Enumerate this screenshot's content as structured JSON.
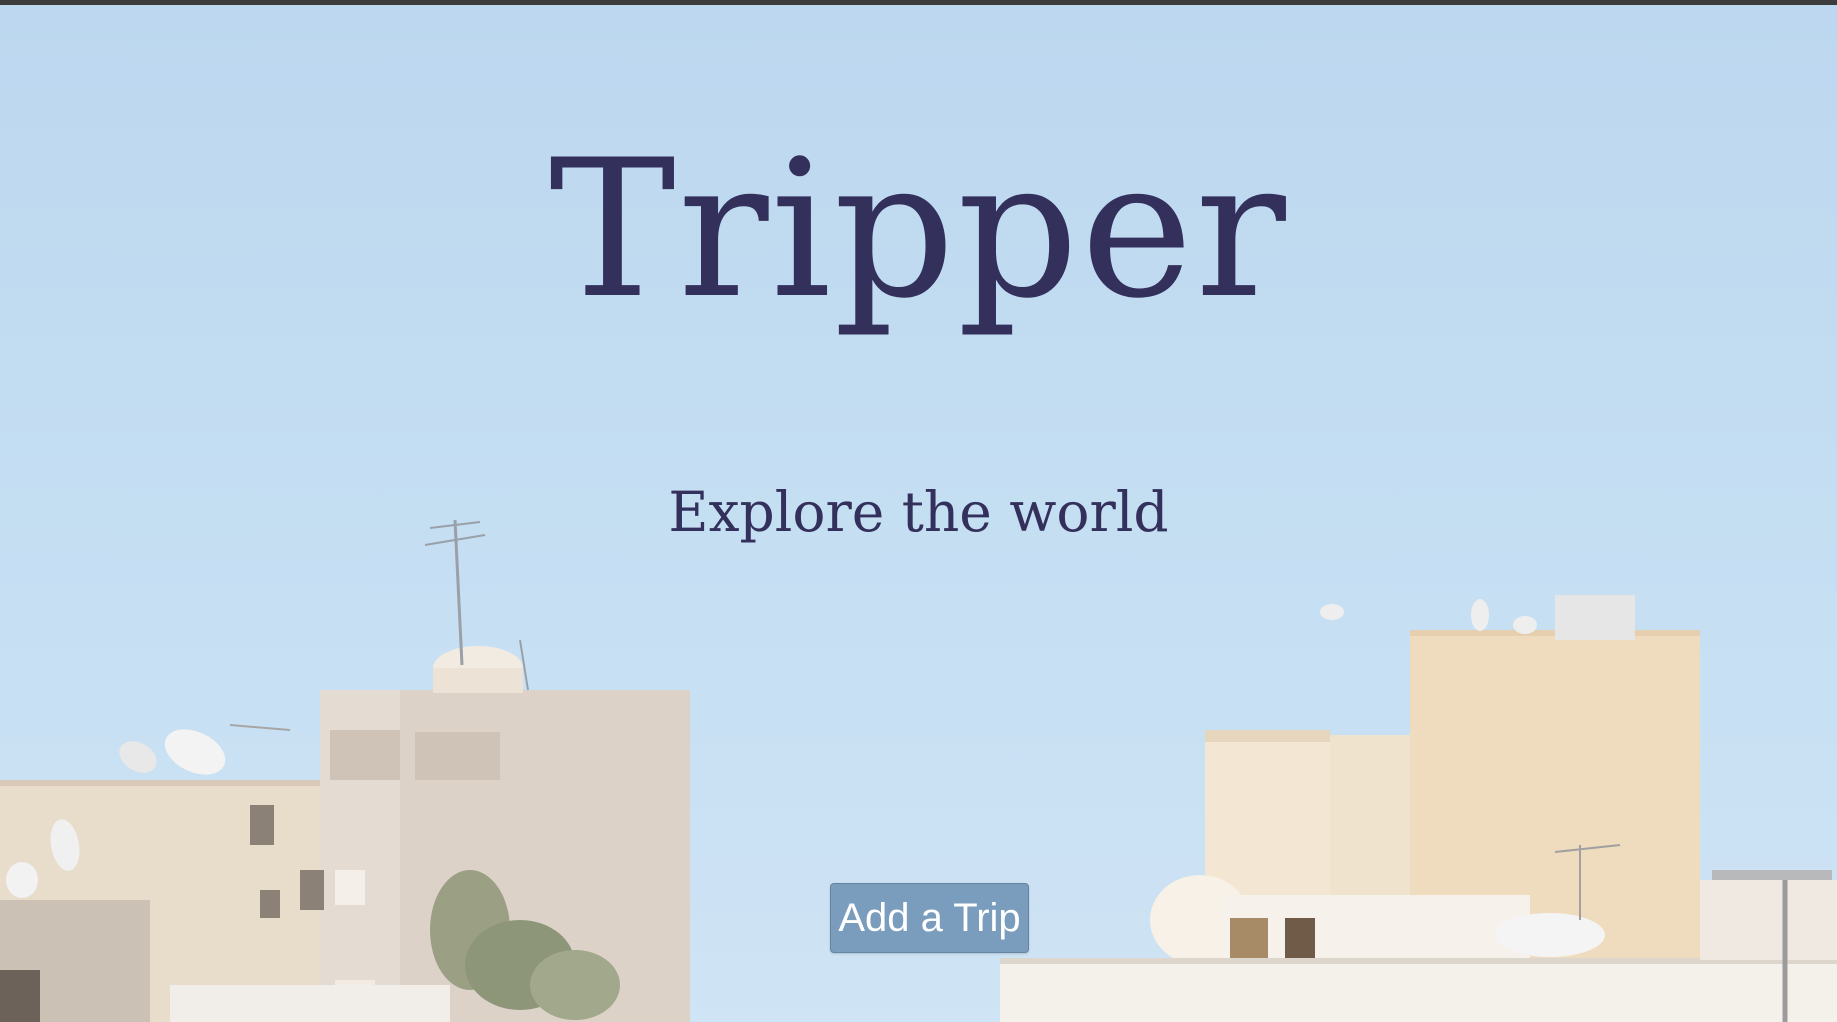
{
  "hero": {
    "title": "Tripper",
    "subtitle": "Explore the world",
    "button_label": "Add a Trip"
  },
  "colors": {
    "sky": "#c1dbf1",
    "text": "#33305c",
    "button": "#7a9cbd",
    "button_text": "#ffffff",
    "building_left": "#e7dccd",
    "building_right": "#efdcc0"
  },
  "background_image": "rooftops-skyline"
}
